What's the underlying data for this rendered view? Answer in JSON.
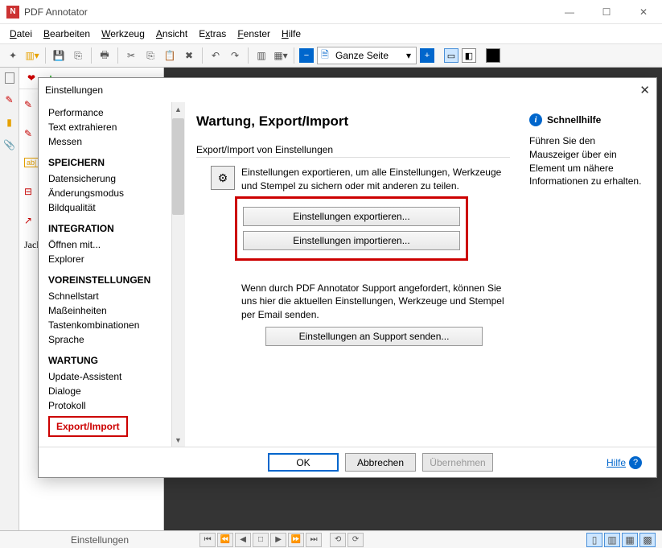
{
  "titlebar": {
    "title": "PDF Annotator"
  },
  "menu": {
    "file": "Datei",
    "edit": "Bearbeiten",
    "tool": "Werkzeug",
    "view": "Ansicht",
    "extras": "Extras",
    "window": "Fenster",
    "help": "Hilfe"
  },
  "toolbar": {
    "zoom_label": "Ganze Seite"
  },
  "statusbar": {
    "text": "Einstellungen"
  },
  "dialog": {
    "title": "Einstellungen",
    "nav": {
      "items_top": [
        "Performance",
        "Text extrahieren",
        "Messen"
      ],
      "group_save": {
        "head": "SPEICHERN",
        "items": [
          "Datensicherung",
          "Änderungsmodus",
          "Bildqualität"
        ]
      },
      "group_int": {
        "head": "INTEGRATION",
        "items": [
          "Öffnen mit...",
          "Explorer"
        ]
      },
      "group_pref": {
        "head": "VOREINSTELLUNGEN",
        "items": [
          "Schnellstart",
          "Maßeinheiten",
          "Tastenkombinationen",
          "Sprache"
        ]
      },
      "group_maint": {
        "head": "WARTUNG",
        "items": [
          "Update-Assistent",
          "Dialoge",
          "Protokoll"
        ],
        "selected": "Export/Import"
      }
    },
    "main": {
      "heading": "Wartung, Export/Import",
      "section1_label": "Export/Import von Einstellungen",
      "block1_text": "Einstellungen exportieren, um alle Einstellungen, Werkzeuge und Stempel zu sichern oder mit anderen zu teilen.",
      "btn_export": "Einstellungen exportieren...",
      "btn_import": "Einstellungen importieren...",
      "block2_text": "Wenn durch PDF Annotator Support angefordert, können Sie uns hier die aktuellen Einstellungen, Werkzeuge und Stempel per Email senden.",
      "btn_support": "Einstellungen an Support senden..."
    },
    "quickhelp": {
      "title": "Schnellhilfe",
      "text": "Führen Sie den Mauszeiger über ein Element um nähere Informationen zu erhalten."
    },
    "footer": {
      "ok": "OK",
      "cancel": "Abbrechen",
      "apply": "Übernehmen",
      "help": "Hilfe"
    }
  }
}
